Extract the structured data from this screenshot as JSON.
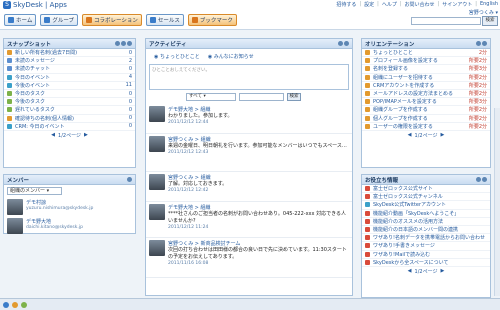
{
  "app": {
    "title": "SkyDesk | Apps",
    "user": "宮野つくみ ▾"
  },
  "header": {
    "links": [
      "招待する",
      "設定",
      "ヘルプ",
      "お問い合わせ",
      "サインアウト",
      "English"
    ],
    "search_button": "検索"
  },
  "nav": [
    {
      "label": "ホーム",
      "icon": "home-icon"
    },
    {
      "label": "グループ",
      "icon": "group-icon"
    },
    {
      "label": "コラボレーション",
      "icon": "collab-icon"
    },
    {
      "label": "セールス",
      "icon": "sales-icon"
    },
    {
      "label": "ブックマーク",
      "icon": "bookmark-icon"
    }
  ],
  "snapshot": {
    "title": "スナップショット",
    "items": [
      {
        "label": "新しい所有名刺(過去7日間)",
        "count": "0"
      },
      {
        "label": "未読のメッセージ",
        "count": "2"
      },
      {
        "label": "未読のチャット",
        "count": "0"
      },
      {
        "label": "今日のイベント",
        "count": "4"
      },
      {
        "label": "今後のイベント",
        "count": "11"
      },
      {
        "label": "今日のタスク",
        "count": "0"
      },
      {
        "label": "今後のタスク",
        "count": "0"
      },
      {
        "label": "遅れているタスク",
        "count": "0"
      },
      {
        "label": "確認待ちの名刺(個人情報)",
        "count": "0"
      },
      {
        "label": "CRM: 今日のイベント",
        "count": "0"
      }
    ],
    "pager": "1/2ページ"
  },
  "members": {
    "title": "メンバー",
    "select": "組織のメンバー",
    "people": [
      {
        "name": "デモ村諒",
        "email": "yuzuru.nishimura@skydesk.jp"
      },
      {
        "name": "デモ野大地",
        "email": "daichi.kitano@skydesk.jp"
      }
    ]
  },
  "activity": {
    "title": "アクティビティ",
    "tab1": "ちょっとひとこと",
    "tab2": "みんなにお知らせ",
    "input_placeholder": "ひとことおしえてください。",
    "filter": "すべて",
    "search_button": "検索",
    "posts": [
      {
        "author": "デモ野大地 > 組織",
        "text": "わかりました。参加します。",
        "time": "2011/12/12 12:44"
      },
      {
        "author": "宮野つくみ > 組織",
        "text": "来週の金曜日、明日朝礼を行います。参加可能なメンバーはいつでもスペース…",
        "time": "2011/12/12 12:43"
      },
      {
        "author": "宮野つくみ > 組織",
        "text": "了解。対応しておきます。",
        "time": "2011/12/12 12:42"
      },
      {
        "author": "デモ野大地 > 組織",
        "text": "****社さんのご担当者の名刺がお問い合わせあり。045-222-xxx 対応できる人いませんか?",
        "time": "2011/12/12 11:24"
      },
      {
        "author": "宮野つくみ > 新商品検討チーム",
        "text": "次回の打ち合わせは田田様の都合の良い日で先に決めています。11:30スタートの予定をお伝えしてあります。",
        "time": "2011/11/16 16:08"
      }
    ]
  },
  "orientation": {
    "title": "オリエンテーション",
    "items": [
      {
        "label": "ちょっとひとこと",
        "tag": "2分"
      },
      {
        "label": "プロフィール画像を設定する",
        "tag": "所要2分"
      },
      {
        "label": "名刺を登録する",
        "tag": "所要3分"
      },
      {
        "label": "組織にユーザーを招待する",
        "tag": "所要2分"
      },
      {
        "label": "CRMアカウントを作成する",
        "tag": "所要2分"
      },
      {
        "label": "メールアドレスの設定方法まとめる",
        "tag": "所要2分"
      },
      {
        "label": "POP/IMAPメールを設定する",
        "tag": "所要3分"
      },
      {
        "label": "組織グループを作成する",
        "tag": "所要2分"
      },
      {
        "label": "個人グループを作成する",
        "tag": "所要2分"
      },
      {
        "label": "ユーザーの権限を設定する",
        "tag": "所要2分"
      }
    ],
    "pager": "1/2ページ"
  },
  "info": {
    "title": "お役立ち情報",
    "items": [
      "富士ゼロックス公式サイト",
      "富士ゼロックス公式チャンネル",
      "SkyDesk公式Twitterアカウント",
      "機能紹介動画「SkyDeskへようこそ」",
      "機能紹介のオススメの活用方法",
      "機能紹介の日本語のメンバー間の連携",
      "ワザあり!名刺データを携帯電話からお問い合わせ",
      "ワザあり!手書きメッセージ",
      "ワザあり!Mailで読み込む",
      "SkyDeskから全スペースについて"
    ],
    "pager": "1/2ページ"
  }
}
